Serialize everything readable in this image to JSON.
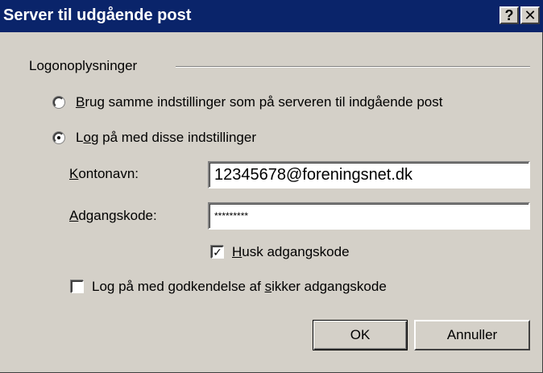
{
  "window": {
    "title": "Server til udgående post",
    "help_glyph": "?",
    "close_glyph": "✕"
  },
  "group": {
    "label": "Logonoplysninger"
  },
  "options": {
    "same_settings": {
      "mnemonic": "B",
      "rest": "rug samme indstillinger som på serveren til indgående post",
      "selected": false
    },
    "log_on_with": {
      "pre": "L",
      "mnemonic": "o",
      "rest": "g på med disse indstillinger",
      "selected": true
    }
  },
  "fields": {
    "account": {
      "mnemonic": "K",
      "rest": "ontonavn:",
      "value": "12345678@foreningsnet.dk"
    },
    "password": {
      "mnemonic": "A",
      "rest": "dgangskode:",
      "value": "*********"
    }
  },
  "remember_password": {
    "mnemonic": "H",
    "rest": "usk adgangskode",
    "checked": true,
    "check_glyph": "✓"
  },
  "secure_auth": {
    "pre": "Log på med godkendelse af ",
    "mnemonic": "s",
    "rest": "ikker adgangskode",
    "checked": false
  },
  "buttons": {
    "ok": "OK",
    "cancel": "Annuller"
  }
}
